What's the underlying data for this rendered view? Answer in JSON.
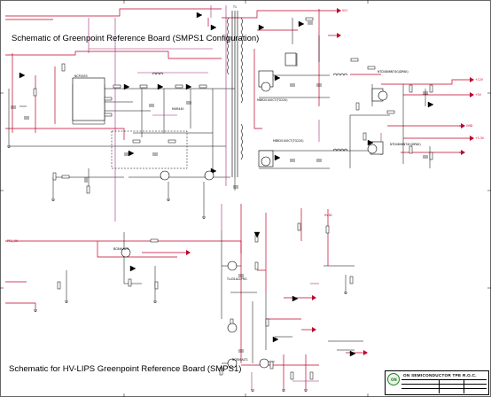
{
  "titles": {
    "smps1": "Schematic of Greenpoint Reference Board  (SMPS1 Configuration)",
    "hvlips": "Schematic for HV-LIPS Greenpoint Reference Board (SMPS1)"
  },
  "title_block": {
    "company": "ON SEMICONDUCTOR TPE R.O.C."
  },
  "components": {
    "ic1": "NCP1653",
    "ic_mosfet_a": "MBR20100CT(TO220)",
    "ic_mosfet_b": "MBR20100CT(TO220)",
    "q_top": "NTD4806NT4G(DPAK)",
    "q_bottom": "NTD4806NT4G(DPAK)",
    "t_main": "T1",
    "d_main": "MUR440",
    "u_ref": "TL431ACLPRG",
    "q_low": "BC846ALT1",
    "q_low2": "BC856ALT1"
  },
  "nets": {
    "v12": "+12V",
    "v5": "+5V",
    "v33": "+3.3V",
    "vcc": "VCC",
    "hv": "HVDC",
    "gnd": "GND",
    "pfc": "PFC_OK"
  }
}
